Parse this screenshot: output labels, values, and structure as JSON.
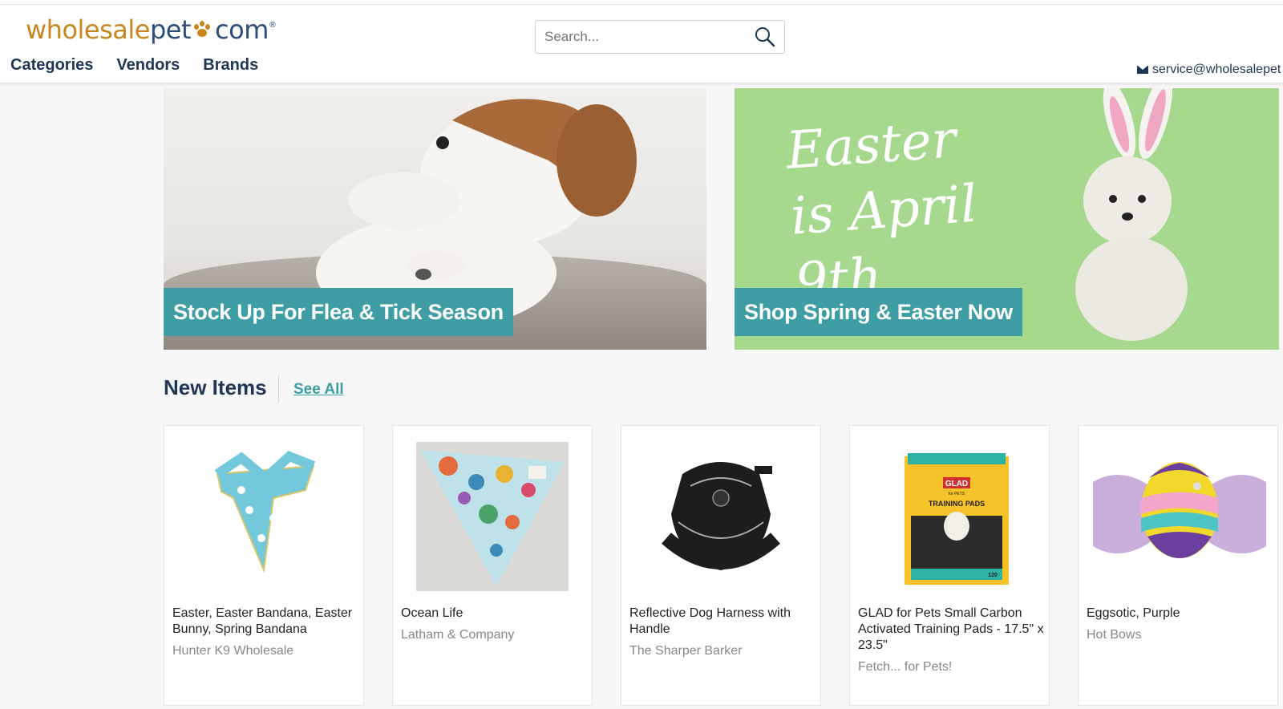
{
  "logo": {
    "wholesale": "wholesale",
    "pet": "pet",
    "com": "com",
    "reg": "®"
  },
  "nav": {
    "categories": "Categories",
    "vendors": "Vendors",
    "brands": "Brands"
  },
  "search": {
    "placeholder": "Search..."
  },
  "header": {
    "email": "service@wholesalepet"
  },
  "banners": [
    {
      "caption": "Stock Up For Flea & Tick Season"
    },
    {
      "caption": "Shop Spring & Easter Now",
      "headline": "Easter is April 9th"
    }
  ],
  "new_items": {
    "title": "New Items",
    "see_all": "See All",
    "items": [
      {
        "name": "Easter, Easter Bandana, Easter Bunny, Spring Bandana",
        "vendor": "Hunter K9 Wholesale"
      },
      {
        "name": "Ocean Life",
        "vendor": "Latham & Company"
      },
      {
        "name": "Reflective Dog Harness with Handle",
        "vendor": "The Sharper Barker"
      },
      {
        "name": "GLAD for Pets Small Carbon Activated Training Pads - 17.5\" x 23.5\"",
        "vendor": "Fetch... for Pets!"
      },
      {
        "name": "Eggsotic, Purple",
        "vendor": "Hot Bows"
      }
    ]
  },
  "product_labels": {
    "glad": "GLAD",
    "for_pets": "for PETS",
    "training_pads": "TRAINING PADS",
    "count": "120"
  },
  "colors": {
    "brand_orange": "#c8871e",
    "brand_navy": "#1f3656",
    "teal": "#3e9ea3",
    "easter_green": "#a6d88d"
  }
}
